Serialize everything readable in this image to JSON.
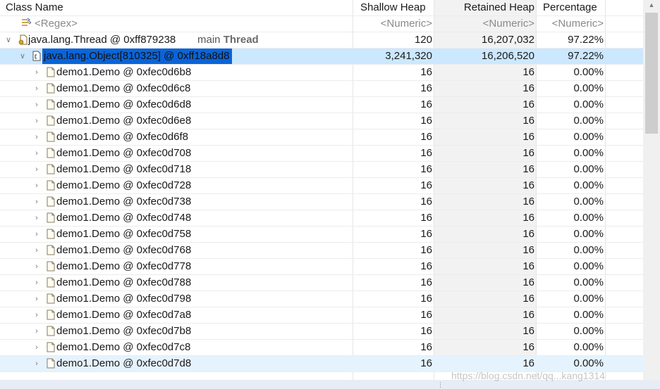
{
  "columns": {
    "class_name": "Class Name",
    "shallow_heap": "Shallow Heap",
    "retained_heap": "Retained Heap",
    "percentage": "Percentage"
  },
  "filters": {
    "class_name": "<Regex>",
    "shallow_heap": "<Numeric>",
    "retained_heap": "<Numeric>",
    "percentage": "<Numeric>"
  },
  "rows": [
    {
      "level": 0,
      "expanded": true,
      "icon": "thread-object-icon",
      "name": "java.lang.Thread @ 0xff879238",
      "suffix_prefix": "main",
      "suffix_bold": "Thread",
      "shallow": "120",
      "retained": "16,207,032",
      "percentage": "97.22%",
      "state": "normal"
    },
    {
      "level": 1,
      "expanded": true,
      "icon": "array-object-icon",
      "name": "java.lang.Object[810325] @ 0xff18a8d8",
      "shallow": "3,241,320",
      "retained": "16,206,520",
      "percentage": "97.22%",
      "state": "selected"
    },
    {
      "level": 2,
      "expanded": false,
      "icon": "object-icon",
      "name": "demo1.Demo @ 0xfec0d6b8",
      "shallow": "16",
      "retained": "16",
      "percentage": "0.00%",
      "state": "normal"
    },
    {
      "level": 2,
      "expanded": false,
      "icon": "object-icon",
      "name": "demo1.Demo @ 0xfec0d6c8",
      "shallow": "16",
      "retained": "16",
      "percentage": "0.00%",
      "state": "normal"
    },
    {
      "level": 2,
      "expanded": false,
      "icon": "object-icon",
      "name": "demo1.Demo @ 0xfec0d6d8",
      "shallow": "16",
      "retained": "16",
      "percentage": "0.00%",
      "state": "normal"
    },
    {
      "level": 2,
      "expanded": false,
      "icon": "object-icon",
      "name": "demo1.Demo @ 0xfec0d6e8",
      "shallow": "16",
      "retained": "16",
      "percentage": "0.00%",
      "state": "normal"
    },
    {
      "level": 2,
      "expanded": false,
      "icon": "object-icon",
      "name": "demo1.Demo @ 0xfec0d6f8",
      "shallow": "16",
      "retained": "16",
      "percentage": "0.00%",
      "state": "normal"
    },
    {
      "level": 2,
      "expanded": false,
      "icon": "object-icon",
      "name": "demo1.Demo @ 0xfec0d708",
      "shallow": "16",
      "retained": "16",
      "percentage": "0.00%",
      "state": "normal"
    },
    {
      "level": 2,
      "expanded": false,
      "icon": "object-icon",
      "name": "demo1.Demo @ 0xfec0d718",
      "shallow": "16",
      "retained": "16",
      "percentage": "0.00%",
      "state": "normal"
    },
    {
      "level": 2,
      "expanded": false,
      "icon": "object-icon",
      "name": "demo1.Demo @ 0xfec0d728",
      "shallow": "16",
      "retained": "16",
      "percentage": "0.00%",
      "state": "normal"
    },
    {
      "level": 2,
      "expanded": false,
      "icon": "object-icon",
      "name": "demo1.Demo @ 0xfec0d738",
      "shallow": "16",
      "retained": "16",
      "percentage": "0.00%",
      "state": "normal"
    },
    {
      "level": 2,
      "expanded": false,
      "icon": "object-icon",
      "name": "demo1.Demo @ 0xfec0d748",
      "shallow": "16",
      "retained": "16",
      "percentage": "0.00%",
      "state": "normal"
    },
    {
      "level": 2,
      "expanded": false,
      "icon": "object-icon",
      "name": "demo1.Demo @ 0xfec0d758",
      "shallow": "16",
      "retained": "16",
      "percentage": "0.00%",
      "state": "normal"
    },
    {
      "level": 2,
      "expanded": false,
      "icon": "object-icon",
      "name": "demo1.Demo @ 0xfec0d768",
      "shallow": "16",
      "retained": "16",
      "percentage": "0.00%",
      "state": "normal"
    },
    {
      "level": 2,
      "expanded": false,
      "icon": "object-icon",
      "name": "demo1.Demo @ 0xfec0d778",
      "shallow": "16",
      "retained": "16",
      "percentage": "0.00%",
      "state": "normal"
    },
    {
      "level": 2,
      "expanded": false,
      "icon": "object-icon",
      "name": "demo1.Demo @ 0xfec0d788",
      "shallow": "16",
      "retained": "16",
      "percentage": "0.00%",
      "state": "normal"
    },
    {
      "level": 2,
      "expanded": false,
      "icon": "object-icon",
      "name": "demo1.Demo @ 0xfec0d798",
      "shallow": "16",
      "retained": "16",
      "percentage": "0.00%",
      "state": "normal"
    },
    {
      "level": 2,
      "expanded": false,
      "icon": "object-icon",
      "name": "demo1.Demo @ 0xfec0d7a8",
      "shallow": "16",
      "retained": "16",
      "percentage": "0.00%",
      "state": "normal"
    },
    {
      "level": 2,
      "expanded": false,
      "icon": "object-icon",
      "name": "demo1.Demo @ 0xfec0d7b8",
      "shallow": "16",
      "retained": "16",
      "percentage": "0.00%",
      "state": "normal"
    },
    {
      "level": 2,
      "expanded": false,
      "icon": "object-icon",
      "name": "demo1.Demo @ 0xfec0d7c8",
      "shallow": "16",
      "retained": "16",
      "percentage": "0.00%",
      "state": "normal"
    },
    {
      "level": 2,
      "expanded": false,
      "icon": "object-icon",
      "name": "demo1.Demo @ 0xfec0d7d8",
      "shallow": "16",
      "retained": "16",
      "percentage": "0.00%",
      "state": "hover"
    }
  ],
  "watermark": "https://blog.csdn.net/qq...kang1314",
  "colors": {
    "selection": "#cce8ff",
    "selected_label_bg": "#0a64d8",
    "hover": "#e5f3ff",
    "retained_column_bg": "#f2f2f2"
  }
}
